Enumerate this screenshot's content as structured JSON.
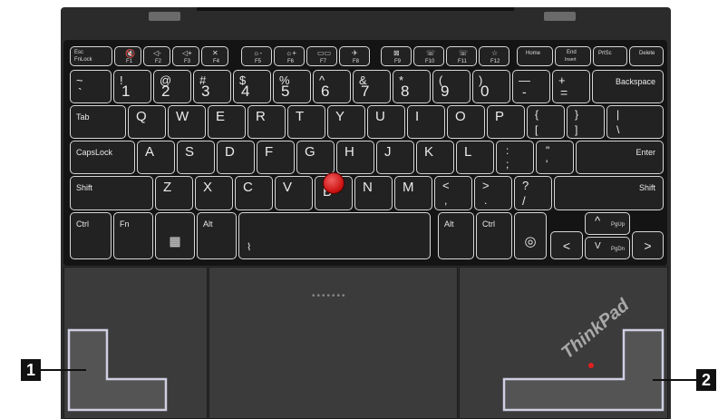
{
  "keyboard": {
    "fn_row": [
      {
        "id": "esc",
        "top": "Esc",
        "bottom": "FnLock"
      },
      {
        "id": "f1",
        "icon": "🔇",
        "label": "F1"
      },
      {
        "id": "f2",
        "icon": "◁-",
        "label": "F2"
      },
      {
        "id": "f3",
        "icon": "◁+",
        "label": "F3"
      },
      {
        "id": "f4",
        "icon": "✕",
        "label": "F4"
      },
      {
        "id": "f5",
        "icon": "☼-",
        "label": "F5"
      },
      {
        "id": "f6",
        "icon": "☼+",
        "label": "F6"
      },
      {
        "id": "f7",
        "icon": "▭▭",
        "label": "F7"
      },
      {
        "id": "f8",
        "icon": "✈",
        "label": "F8"
      },
      {
        "id": "f9",
        "icon": "⊠",
        "label": "F9"
      },
      {
        "id": "f10",
        "icon": "☏",
        "label": "F10"
      },
      {
        "id": "f11",
        "icon": "☏",
        "label": "F11"
      },
      {
        "id": "f12",
        "icon": "☆",
        "label": "F12"
      },
      {
        "id": "home",
        "top": "Home"
      },
      {
        "id": "end",
        "top": "End",
        "bottom": "Insert"
      },
      {
        "id": "prtsc",
        "top": "PrtSc"
      },
      {
        "id": "delete",
        "top": "Delete"
      }
    ],
    "number_row": [
      {
        "shift": "~",
        "base": "`"
      },
      {
        "shift": "!",
        "base": "1"
      },
      {
        "shift": "@",
        "base": "2"
      },
      {
        "shift": "#",
        "base": "3"
      },
      {
        "shift": "$",
        "base": "4"
      },
      {
        "shift": "%",
        "base": "5"
      },
      {
        "shift": "^",
        "base": "6"
      },
      {
        "shift": "&",
        "base": "7"
      },
      {
        "shift": "*",
        "base": "8"
      },
      {
        "shift": "(",
        "base": "9"
      },
      {
        "shift": ")",
        "base": "0"
      },
      {
        "shift": "—",
        "base": "-"
      },
      {
        "shift": "+",
        "base": "="
      }
    ],
    "backspace": "Backspace",
    "tab": "Tab",
    "qwerty": [
      "Q",
      "W",
      "E",
      "R",
      "T",
      "Y",
      "U",
      "I",
      "O",
      "P"
    ],
    "brackets": [
      {
        "shift": "{",
        "base": "["
      },
      {
        "shift": "}",
        "base": "]"
      },
      {
        "shift": "|",
        "base": "\\"
      }
    ],
    "capslock": "CapsLock",
    "home_row": [
      "A",
      "S",
      "D",
      "F",
      "G",
      "H",
      "J",
      "K",
      "L"
    ],
    "semicolon": {
      "shift": ":",
      "base": ";"
    },
    "quote": {
      "shift": "\"",
      "base": "'"
    },
    "enter": "Enter",
    "shift_left": "Shift",
    "bottom_letters": [
      "Z",
      "X",
      "C",
      "V",
      "B",
      "N",
      "M"
    ],
    "comma": {
      "shift": "<",
      "base": ","
    },
    "period": {
      "shift": ">",
      "base": "."
    },
    "slash": {
      "shift": "?",
      "base": "/"
    },
    "shift_right": "Shift",
    "ctrl_left": "Ctrl",
    "fn": "Fn",
    "windows_icon": "▦",
    "alt_left": "Alt",
    "space_icon": "⌇",
    "alt_right": "Alt",
    "ctrl_right": "Ctrl",
    "fingerprint_icon": "◎",
    "arrow_left": "<",
    "arrow_up": "^",
    "pgup": "PgUp",
    "arrow_down": "V",
    "pgdn": "PgDn",
    "arrow_right": ">"
  },
  "touchpad": {
    "dots": "•••••••"
  },
  "logo": {
    "text": "ThinkPad"
  },
  "callouts": [
    {
      "number": "1"
    },
    {
      "number": "2"
    }
  ],
  "colors": {
    "trackpoint": "#d01818",
    "zone_border": "#cfcfe3"
  }
}
